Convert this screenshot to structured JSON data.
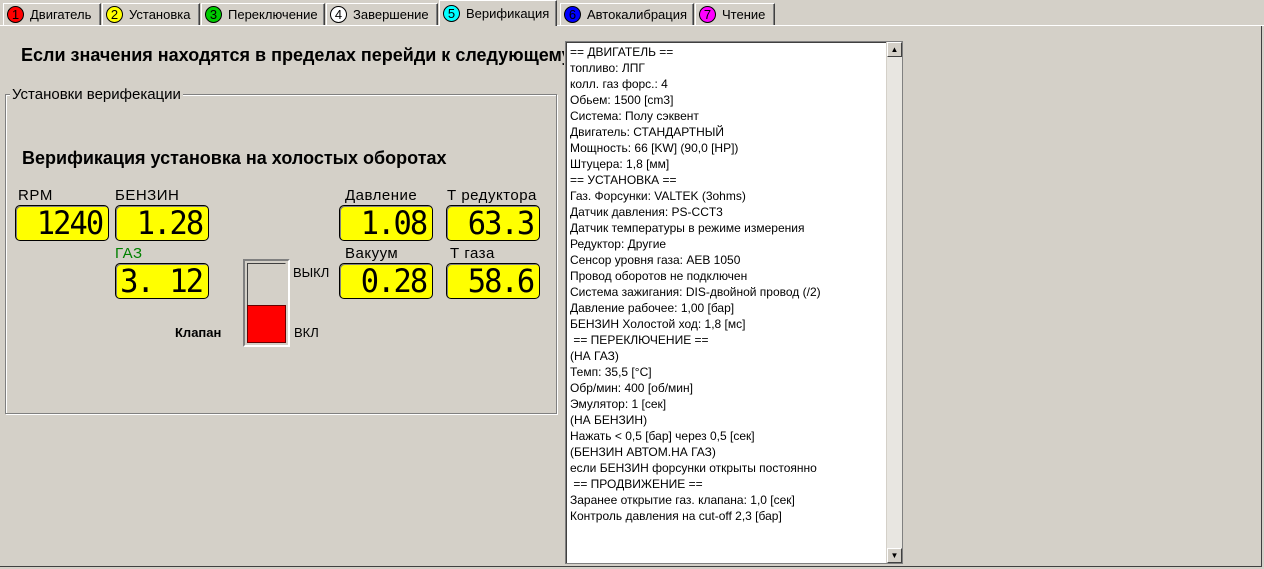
{
  "tabs": [
    {
      "num": "1",
      "label": "Двигатель",
      "color": "#ff0000"
    },
    {
      "num": "2",
      "label": "Установка",
      "color": "#ffff00"
    },
    {
      "num": "3",
      "label": "Переключение",
      "color": "#00cc00"
    },
    {
      "num": "4",
      "label": "Завершение",
      "color": "#ffffff"
    },
    {
      "num": "5",
      "label": "Верификация",
      "color": "#00ffff"
    },
    {
      "num": "6",
      "label": "Автокалибрация",
      "color": "#0000ff"
    },
    {
      "num": "7",
      "label": "Чтение",
      "color": "#ff00ff"
    }
  ],
  "active_tab": "Верификация",
  "headline": "Если значения находятся в пределах перейди к следующему",
  "group_title": "Установки верифекации",
  "subtitle": "Верификация установка на холостых оборотах",
  "gauges": {
    "rpm": {
      "label": "RPM",
      "value": "1240"
    },
    "benzin": {
      "label": "БЕНЗИН",
      "value": "1.28"
    },
    "gaz": {
      "label": "ГАЗ",
      "value": "3. 12"
    },
    "pressure": {
      "label": "Давление",
      "value": "1.08"
    },
    "t_reducer": {
      "label": "Т редуктора",
      "value": "63.3"
    },
    "vacuum": {
      "label": "Вакуум",
      "value": "0.28"
    },
    "t_gas": {
      "label": "Т газа",
      "value": "58.6"
    }
  },
  "valve": {
    "label": "Клапан",
    "off_label": "ВЫКЛ",
    "on_label": "ВКЛ",
    "state_color": "#ff0000"
  },
  "log_lines": [
    "== ДВИГАТЕЛЬ ==",
    "топливо: ЛПГ",
    "колл. газ форс.: 4",
    "Обьем: 1500 [cm3]",
    "Система: Полу сэквент",
    "Двигатель: СТАНДАРТНЫЙ",
    "Мощность: 66 [KW] (90,0 [HP])",
    "Штуцера: 1,8 [мм]",
    "== УСТАНОВКА ==",
    "Газ. Форсунки: VALTEK (3ohms)",
    "Датчик давления: PS-CCT3",
    "Датчик температуры в режиме измерения",
    "Редуктор: Другие",
    "Сенсор уровня газа: AEB 1050",
    "Провод оборотов не подключен",
    "Система зажигания: DIS-двойной провод (/2)",
    "Давление рабочее: 1,00 [бар]",
    "БЕНЗИН Холостой ход: 1,8 [мс]",
    " == ПЕРЕКЛЮЧЕНИЕ ==",
    "(НА ГАЗ)",
    "Темп: 35,5 [°C]",
    "Обр/мин: 400 [об/мин]",
    "Эмулятор: 1 [сек]",
    "(НА БЕНЗИН)",
    "Нажать < 0,5 [бар] через 0,5 [сек]",
    "(БЕНЗИН АВТОМ.НА ГАЗ)",
    "если БЕНЗИН форсунки открыты постоянно",
    " == ПРОДВИЖЕНИЕ ==",
    "Заранее открытие газ. клапана: 1,0 [сек]",
    "Контроль давления на cut-off 2,3 [бар]"
  ]
}
